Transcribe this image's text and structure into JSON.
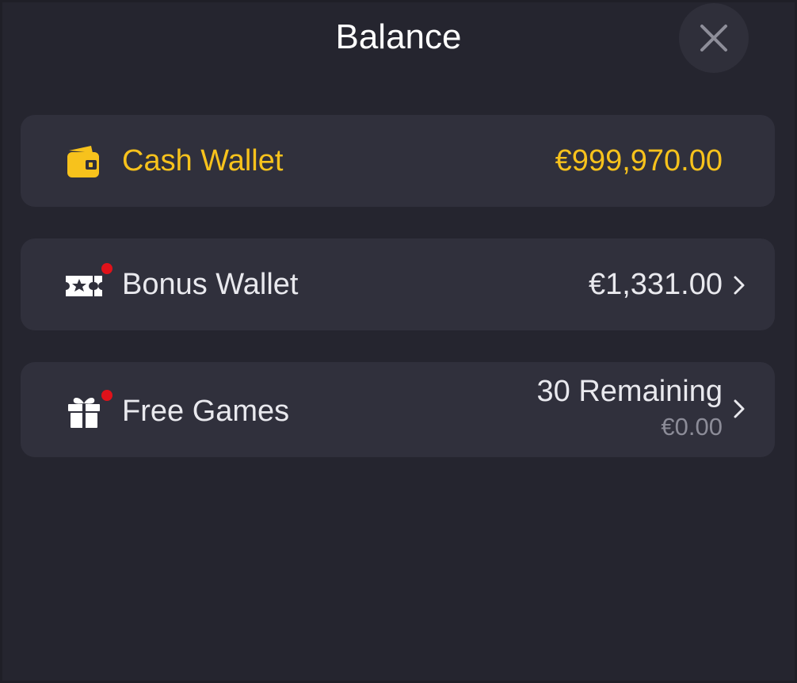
{
  "header": {
    "title": "Balance",
    "close_icon": "close-icon"
  },
  "wallets": [
    {
      "label": "Cash Wallet",
      "amount": "€999,970.00",
      "icon": "wallet-icon",
      "color": "#f7c21c",
      "has_notification": false,
      "has_chevron": false
    },
    {
      "label": "Bonus Wallet",
      "amount": "€1,331.00",
      "icon": "ticket-icon",
      "color": "#e9e9ee",
      "has_notification": true,
      "has_chevron": true
    },
    {
      "label": "Free Games",
      "amount": "30 Remaining",
      "sub_amount": "€0.00",
      "icon": "gift-icon",
      "color": "#e9e9ee",
      "has_notification": true,
      "has_chevron": true
    }
  ],
  "colors": {
    "background": "#25252f",
    "card": "#30303c",
    "accent": "#f7c21c",
    "notification": "#e0121a",
    "muted_text": "#8c8c98"
  }
}
